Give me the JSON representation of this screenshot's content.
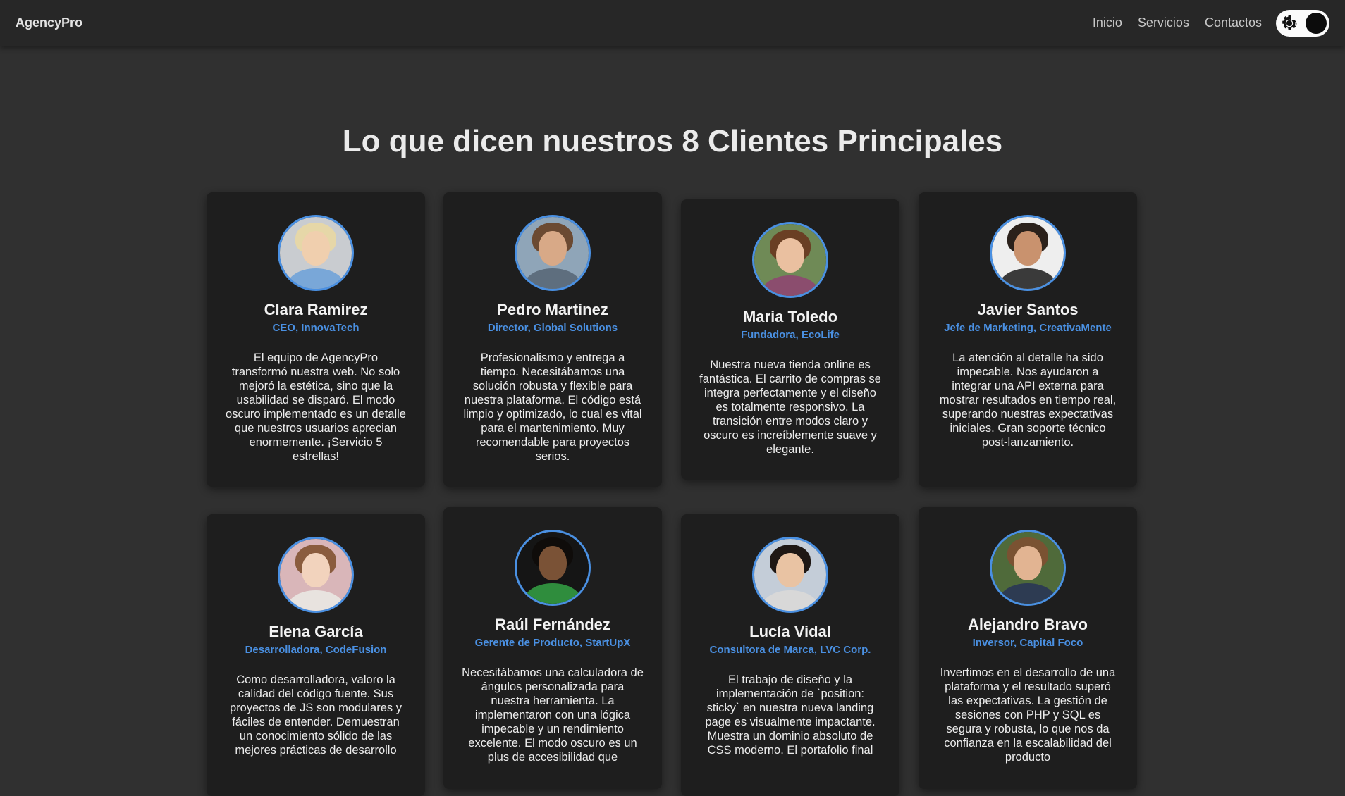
{
  "brand": "AgencyPro",
  "nav": [
    "Inicio",
    "Servicios",
    "Contactos"
  ],
  "title": "Lo que dicen nuestros 8 Clientes Principales",
  "testimonials": [
    {
      "name": "Clara Ramirez",
      "role": "CEO, InnovaTech",
      "quote": "El equipo de AgencyPro transformó nuestra web. No solo mejoró la estética, sino que la usabilidad se disparó. El modo oscuro implementado es un detalle que nuestros usuarios aprecian enormemente. ¡Servicio 5 estrellas!"
    },
    {
      "name": "Pedro Martinez",
      "role": "Director, Global Solutions",
      "quote": "Profesionalismo y entrega a tiempo. Necesitábamos una solución robusta y flexible para nuestra plataforma. El código está limpio y optimizado, lo cual es vital para el mantenimiento. Muy recomendable para proyectos serios."
    },
    {
      "name": "Maria Toledo",
      "role": "Fundadora, EcoLife",
      "quote": "Nuestra nueva tienda online es fantástica. El carrito de compras se integra perfectamente y el diseño es totalmente responsivo. La transición entre modos claro y oscuro es increíblemente suave y elegante."
    },
    {
      "name": "Javier Santos",
      "role": "Jefe de Marketing, CreativaMente",
      "quote": "La atención al detalle ha sido impecable. Nos ayudaron a integrar una API externa para mostrar resultados en tiempo real, superando nuestras expectativas iniciales. Gran soporte técnico post-lanzamiento."
    },
    {
      "name": "Elena García",
      "role": "Desarrolladora, CodeFusion",
      "quote": "Como desarrolladora, valoro la calidad del código fuente. Sus proyectos de JS son modulares y fáciles de entender. Demuestran un conocimiento sólido de las mejores prácticas de desarrollo"
    },
    {
      "name": "Raúl Fernández",
      "role": "Gerente de Producto, StartUpX",
      "quote": "Necesitábamos una calculadora de ángulos personalizada para nuestra herramienta. La implementaron con una lógica impecable y un rendimiento excelente. El modo oscuro es un plus de accesibilidad que"
    },
    {
      "name": "Lucía Vidal",
      "role": "Consultora de Marca, LVC Corp.",
      "quote": "El trabajo de diseño y la implementación de `position: sticky` en nuestra nueva landing page es visualmente impactante. Muestra un dominio absoluto de CSS moderno. El portafolio final"
    },
    {
      "name": "Alejandro Bravo",
      "role": "Inversor, Capital Foco",
      "quote": "Invertimos en el desarrollo de una plataforma y el resultado superó las expectativas. La gestión de sesiones con PHP y SQL es segura y robusta, lo que nos da confianza en la escalabilidad del producto"
    }
  ]
}
